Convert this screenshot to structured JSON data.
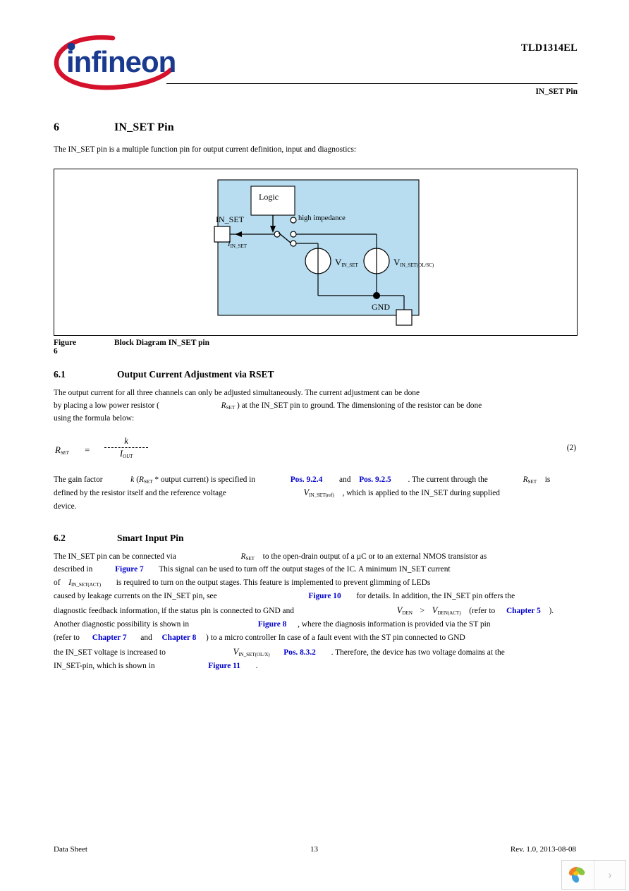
{
  "header": {
    "doc_id": "TLD1314EL",
    "section_title": "IN_SET Pin",
    "logo_name": "infineon"
  },
  "section6": {
    "number": "6",
    "title": "IN_SET Pin",
    "intro": "The IN_SET pin is a multiple function pin for output current definition, input and diagnostics:"
  },
  "figure6": {
    "caption_number": "Figure 6",
    "caption_text": "Block Diagram IN_SET pin",
    "bg_color": "#b8ddf0",
    "labels": {
      "logic": "Logic",
      "in_set_pin": "IN_SET",
      "high_impedance": "high impedance",
      "current": "I",
      "current_sub": "IN_SET",
      "v1": "V",
      "v1_sub": "IN_SET",
      "v2": "V",
      "v2_sub": "IN_SET(OL/SC)",
      "gnd": "GND"
    }
  },
  "section61": {
    "number": "6.1",
    "title": "Output Current Adjustment via RSET",
    "line1": "The output current for all three channels can only be adjusted simultaneously. The current adjustment can be done",
    "line2a": "by placing a low power resistor (",
    "line2_sym": "R",
    "line2_sub": "SET",
    "line2b": ") at the IN_SET pin to ground. The dimensioning of the resistor can be done",
    "line3": "using the formula below:"
  },
  "equation2": {
    "lhs_sym": "R",
    "lhs_sub": "SET",
    "equals": "=",
    "numerator": "k",
    "denominator_sym": "I",
    "denominator_sub": "OUT",
    "number": "(2)"
  },
  "section61_after": {
    "l1_a": "The gain factor",
    "l1_k": "k",
    "l1_b": "(",
    "l1_sym": "R",
    "l1_sub": "SET",
    "l1_c": "* output current) is specified in",
    "l1_ref1": "Pos. 9.2.4",
    "l1_and": "and",
    "l1_ref2": "Pos. 9.2.5",
    "l1_d": ". The current through the",
    "l1_sym2": "R",
    "l1_sub2": "SET",
    "l1_e": "is",
    "l2_a": "defined by the resistor itself and the reference voltage",
    "l2_sym": "V",
    "l2_sub": "IN_SET(ref)",
    "l2_b": ", which is applied to the IN_SET during supplied",
    "l3": "device."
  },
  "section62": {
    "number": "6.2",
    "title": "Smart Input Pin",
    "l1_a": "The IN_SET pin can be connected via",
    "l1_sym": "R",
    "l1_sub": "SET",
    "l1_b": "to the open-drain output of a µC or to an external NMOS transistor as",
    "l2_a": "described in",
    "l2_ref": "Figure 7",
    "l2_b": "This signal can be used to turn off the output stages of the IC. A minimum IN_SET current",
    "l3_a": "of",
    "l3_sym": "I",
    "l3_sub": "IN_SET(ACT)",
    "l3_b": "is required to turn on the output stages. This feature is implemented to prevent glimming of LEDs",
    "l4_a": "caused by leakage currents on the IN_SET pin, see",
    "l4_ref": "Figure 10",
    "l4_b": "for details. In addition, the IN_SET pin offers the",
    "l5_a": "diagnostic feedback information, if the status pin is connected to GND and",
    "l5_sym1": "V",
    "l5_sub1": "DEN",
    "l5_gt": ">",
    "l5_sym2": "V",
    "l5_sub2": "DEN(ACT)",
    "l5_b": "(refer to",
    "l5_ref": "Chapter 5",
    "l5_c": ").",
    "l6_a": "Another diagnostic possibility is shown in",
    "l6_ref": "Figure 8",
    "l6_b": ", where the diagnosis information is provided via the ST pin",
    "l7_a": "(refer to",
    "l7_ref1": "Chapter 7",
    "l7_and": "and",
    "l7_ref2": "Chapter 8",
    "l7_b": ") to a micro controller In case of a fault event with the ST pin connected to GND",
    "l8_a": "the IN_SET voltage is increased to",
    "l8_sym": "V",
    "l8_sub": "IN_SET(OL/X)",
    "l8_ref": "Pos. 8.3.2",
    "l8_b": ". Therefore, the device has two voltage domains at the",
    "l9_a": "IN_SET-pin, which is shown in",
    "l9_ref": "Figure 11",
    "l9_b": "."
  },
  "footer": {
    "left": "Data Sheet",
    "page": "13",
    "right": "Rev. 1.0, 2013-08-08"
  },
  "widget": {
    "logo_name": "colorful-leaf-logo",
    "next_label": "›"
  },
  "colors": {
    "link": "#0000cc",
    "logo_red": "#d5112c",
    "logo_blue": "#1a3a8f",
    "diagram_bg": "#b8ddf0"
  }
}
